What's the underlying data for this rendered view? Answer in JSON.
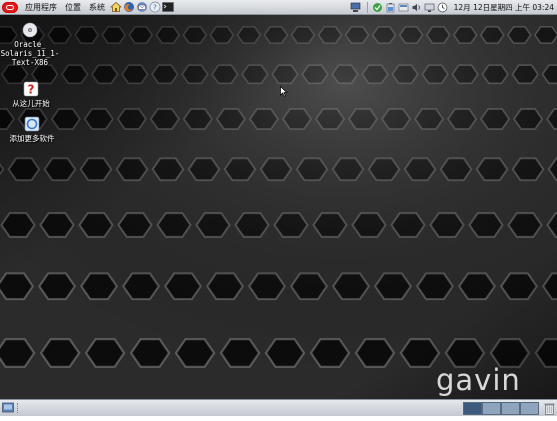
{
  "top_panel": {
    "menus": [
      "应用程序",
      "位置",
      "系统"
    ],
    "launchers": [
      "home-icon",
      "firefox-icon",
      "thunderbird-icon",
      "help-icon",
      "terminal-icon"
    ],
    "tray_icons": [
      "network-icon",
      "update-icon",
      "battery-icon",
      "notify-icon",
      "volume-icon",
      "monitor-icon",
      "clock-icon"
    ],
    "clock": "12月 12日星期四 上午 03:24"
  },
  "desktop": {
    "icons": [
      {
        "name": "dvd-icon",
        "label": "Oracle_\nSolaris_11_1-\nText-X86"
      },
      {
        "name": "help-icon",
        "label": "从这儿开始"
      },
      {
        "name": "add-software-icon",
        "label": "添加更多软件"
      }
    ],
    "watermark": "gavin"
  },
  "bottom_panel": {
    "workspaces": 4,
    "active_workspace": 1
  },
  "colors": {
    "panel_top": "#e9ebee",
    "panel_bottom": "#c6cbd2",
    "oracle_red": "#e31b1b",
    "workspace_active": "#3c5a7e",
    "workspace": "#8fa4bd"
  }
}
